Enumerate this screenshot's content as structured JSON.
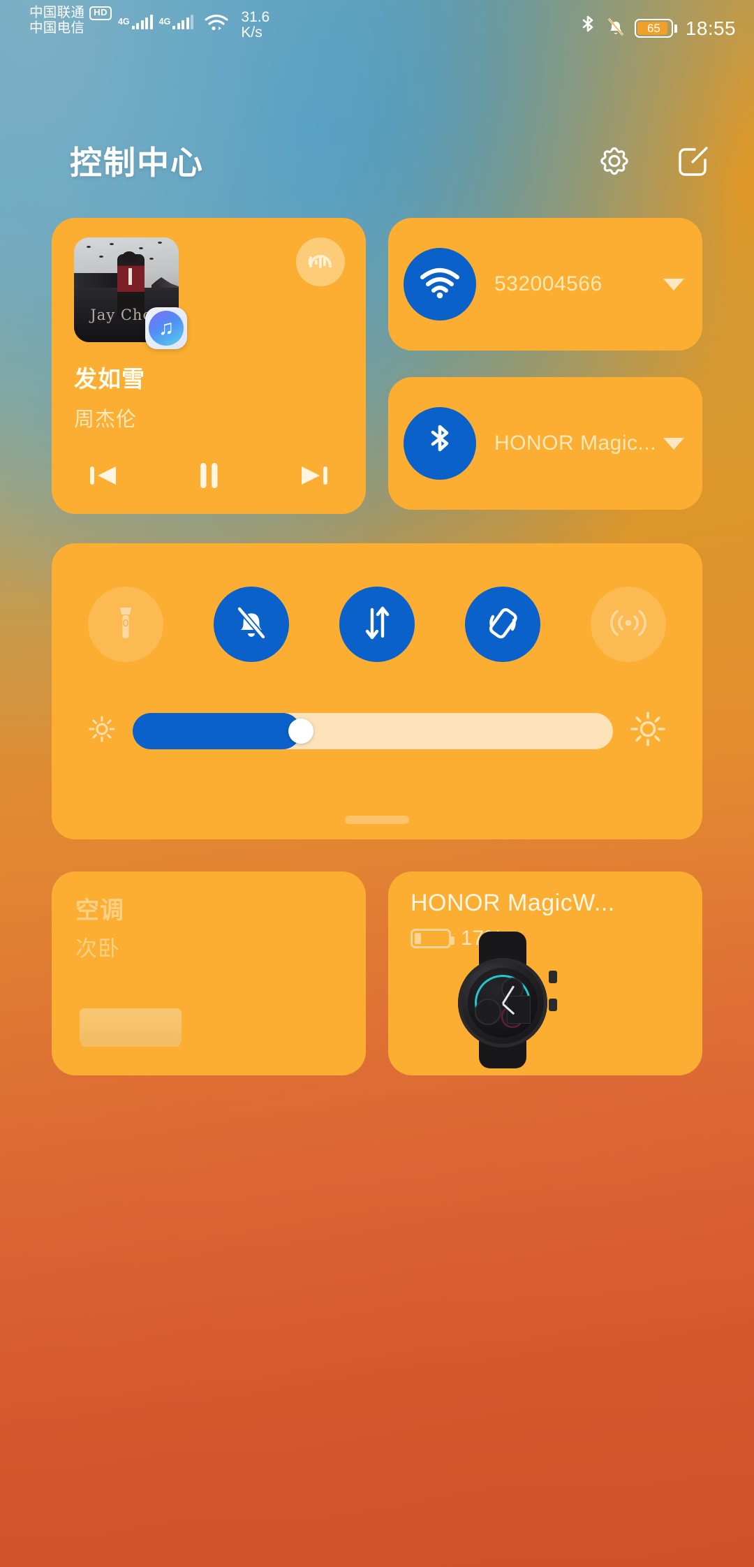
{
  "status_bar": {
    "carrier_primary": "中国联通",
    "carrier_hd_badge": "HD",
    "carrier_secondary": "中国电信",
    "network_type_1": "4G",
    "network_type_2": "4G",
    "net_speed_value": "31.6",
    "net_speed_unit": "K/s",
    "bluetooth_icon": "bluetooth-icon",
    "mute_icon": "bell-off-icon",
    "battery_percent": "65",
    "clock": "18:55"
  },
  "header": {
    "title": "控制中心",
    "settings_icon": "gear-icon",
    "edit_icon": "edit-square-icon"
  },
  "music": {
    "title": "发如雪",
    "artist": "周杰伦",
    "album_art_text": "Jay Chou",
    "app_badge_icon": "music-note-icon",
    "audio_output_icon": "audio-output-waveform-icon",
    "previous_icon": "skip-previous-icon",
    "pause_icon": "pause-icon",
    "next_icon": "skip-next-icon"
  },
  "connectivity": [
    {
      "name": "wifi",
      "icon": "wifi-icon",
      "label": "532004566",
      "state": "on",
      "expand_icon": "chevron-down-icon"
    },
    {
      "name": "bluetooth",
      "icon": "bluetooth-icon",
      "label": "HONOR Magic...",
      "state": "on",
      "expand_icon": "chevron-down-icon"
    }
  ],
  "toggles": [
    {
      "name": "flashlight",
      "icon": "flashlight-icon",
      "state": "off"
    },
    {
      "name": "silent-mode",
      "icon": "bell-off-icon",
      "state": "on"
    },
    {
      "name": "mobile-data",
      "icon": "mobile-data-icon",
      "state": "on"
    },
    {
      "name": "auto-rotate",
      "icon": "rotate-lock-icon",
      "state": "on"
    },
    {
      "name": "hotspot",
      "icon": "hotspot-icon",
      "state": "off"
    }
  ],
  "brightness": {
    "low_icon": "brightness-low-icon",
    "high_icon": "brightness-high-icon",
    "value_percent": 35
  },
  "drag_handle_icon": "drag-handle-icon",
  "devices": [
    {
      "name": "air-conditioner",
      "title": "空调",
      "subtitle": "次卧",
      "image": "air-conditioner-image",
      "state": "offline"
    },
    {
      "name": "smartwatch",
      "title": "HONOR MagicW...",
      "battery": "17%",
      "battery_icon": "battery-low-icon",
      "image": "smartwatch-image"
    }
  ],
  "colors": {
    "card": "#FBAE31",
    "toggle_on": "#0A61C9",
    "text_light": "#FFF7E6",
    "text_muted": "#FDE9B8"
  }
}
